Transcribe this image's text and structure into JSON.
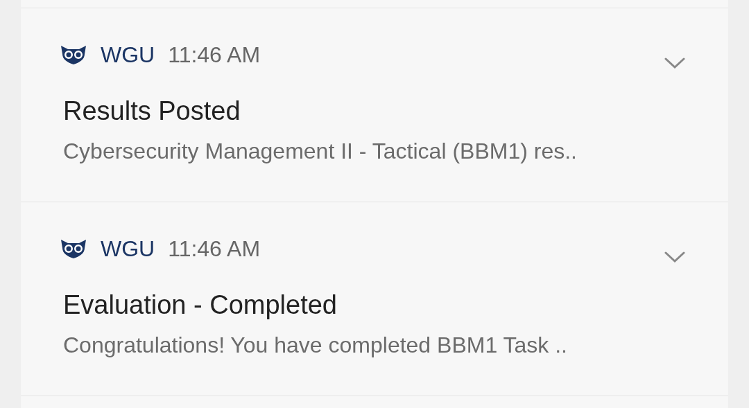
{
  "notifications": [
    {
      "app": "WGU",
      "time": "11:46 AM",
      "title": "Results Posted",
      "body": "Cybersecurity Management II - Tactical (BBM1) res..",
      "expanded": false
    },
    {
      "app": "WGU",
      "time": "11:46 AM",
      "title": "Evaluation - Completed",
      "body": "Congratulations! You have completed BBM1 Task ..",
      "expanded": false
    }
  ]
}
